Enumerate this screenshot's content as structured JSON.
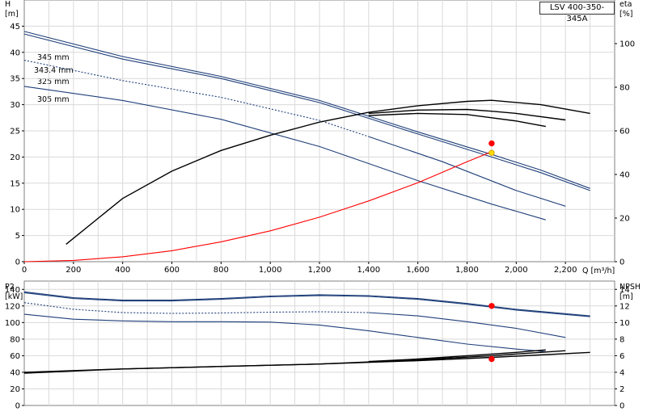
{
  "model": "LSV 400-350-345A",
  "units": {
    "H": "H",
    "H_unit": "[m]",
    "eta": "eta",
    "eta_unit": "[%]",
    "Q": "Q [m³/h]",
    "P2": "P2",
    "P2_unit": "[kW]",
    "NPSH": "NPSH",
    "NPSH_unit": "[m]"
  },
  "impeller_labels": [
    "345 mm",
    "343.4 mm",
    "325 mm",
    "305 mm"
  ],
  "colors": {
    "pump": "#1f3f7a",
    "eff": "#000000",
    "system": "#ff0000",
    "grid": "#d9d9d9"
  },
  "chart_data": [
    {
      "type": "line",
      "name_key": "head",
      "xlim": [
        0,
        2400
      ],
      "ylim": [
        0,
        50
      ],
      "y2lim": [
        0,
        120
      ],
      "xticks": [
        0,
        200,
        400,
        600,
        800,
        1000,
        1200,
        1400,
        1600,
        1800,
        2000,
        2200
      ],
      "xtick_labels": [
        "0",
        "200",
        "400",
        "600",
        "800",
        "1,000",
        "1,200",
        "1,400",
        "1,600",
        "1,800",
        "2,000",
        "2,200"
      ],
      "yticks": [
        0,
        5,
        10,
        15,
        20,
        25,
        30,
        35,
        40,
        45
      ],
      "y2ticks": [
        0,
        20,
        40,
        60,
        80,
        100
      ],
      "grid": true,
      "series": [
        {
          "name": "345 mm",
          "axis": "left",
          "style": "solid",
          "x": [
            0,
            400,
            800,
            1200,
            1600,
            1900,
            2100,
            2300
          ],
          "y": [
            44,
            39.2,
            35.4,
            30.8,
            24.8,
            20.5,
            17.5,
            14.0
          ]
        },
        {
          "name": "343.4 mm",
          "axis": "left",
          "style": "solid",
          "x": [
            0,
            400,
            800,
            1200,
            1600,
            1900,
            2100,
            2300
          ],
          "y": [
            43.5,
            38.7,
            35.0,
            30.4,
            24.4,
            20.0,
            17.0,
            13.6
          ]
        },
        {
          "name": "325 mm",
          "axis": "left",
          "style": "dashed",
          "x": [
            0,
            400,
            800,
            1200,
            1400
          ],
          "y": [
            38.5,
            34.6,
            31.4,
            27.0,
            23.9
          ]
        },
        {
          "name": "325 mm",
          "axis": "left",
          "style": "solid",
          "x": [
            1400,
            1700,
            2000,
            2200
          ],
          "y": [
            23.9,
            19.1,
            13.6,
            10.6
          ]
        },
        {
          "name": "305 mm",
          "axis": "left",
          "style": "solid",
          "x": [
            0,
            400,
            800,
            1200,
            1600,
            1900,
            2120
          ],
          "y": [
            33.5,
            30.8,
            27.2,
            22.0,
            15.5,
            11.0,
            8.0
          ]
        },
        {
          "name": "system",
          "axis": "left",
          "style": "solid",
          "color_key": "system",
          "x": [
            0,
            200,
            400,
            600,
            800,
            1000,
            1200,
            1400,
            1600,
            1800,
            1900
          ],
          "y": [
            0,
            0.24,
            0.94,
            2.1,
            3.8,
            5.9,
            8.5,
            11.6,
            15.1,
            19.1,
            21.0
          ]
        },
        {
          "name": "eta 345 mm",
          "axis": "right",
          "style": "solid",
          "color_key": "eff",
          "x": [
            170,
            400,
            600,
            800,
            1000,
            1200,
            1400,
            1600,
            1800,
            1900,
            2100,
            2300
          ],
          "y": [
            8,
            29,
            41.5,
            51,
            58,
            64,
            68.5,
            71.5,
            73.5,
            74,
            72,
            68
          ]
        },
        {
          "name": "eta 325 mm",
          "axis": "right",
          "style": "solid",
          "color_key": "eff",
          "x": [
            1400,
            1600,
            1800,
            1900,
            2000,
            2200
          ],
          "y": [
            68,
            69.5,
            69.8,
            69,
            68,
            65
          ]
        },
        {
          "name": "eta 305 mm",
          "axis": "right",
          "style": "solid",
          "color_key": "eff",
          "x": [
            1400,
            1600,
            1800,
            1900,
            2000,
            2120
          ],
          "y": [
            67,
            68,
            67.5,
            66,
            64.5,
            62
          ]
        }
      ],
      "duty_points": [
        {
          "x": 1900,
          "y": 22.6,
          "color": "#ff0000"
        },
        {
          "x": 1900,
          "y": 20.8,
          "color": "#ffd700"
        }
      ]
    },
    {
      "type": "line",
      "name_key": "power_npsh",
      "xlim": [
        0,
        2400
      ],
      "ylim": [
        0,
        150
      ],
      "y2lim": [
        0,
        15
      ],
      "yticks": [
        0,
        20,
        40,
        60,
        80,
        100,
        120,
        140
      ],
      "y2ticks": [
        0,
        2,
        4,
        6,
        8,
        10,
        12,
        14
      ],
      "grid": true,
      "series": [
        {
          "name": "P2 345 mm",
          "axis": "left",
          "style": "solid",
          "x": [
            0,
            200,
            400,
            600,
            800,
            1000,
            1200,
            1400,
            1600,
            1800,
            2000,
            2300
          ],
          "y": [
            137,
            130,
            127,
            127,
            129,
            132,
            133.5,
            132.5,
            129,
            123,
            116,
            108
          ]
        },
        {
          "name": "P2 343.4 mm",
          "axis": "left",
          "style": "solid",
          "x": [
            0,
            200,
            400,
            600,
            800,
            1000,
            1200,
            1400,
            1600,
            1800,
            2000,
            2300
          ],
          "y": [
            136,
            129,
            126,
            126,
            128,
            131,
            132.5,
            131.5,
            128,
            122,
            115,
            107
          ]
        },
        {
          "name": "P2 325 mm",
          "axis": "left",
          "style": "dashed",
          "x": [
            0,
            200,
            400,
            600,
            800,
            1000,
            1200,
            1400
          ],
          "y": [
            124,
            116,
            112,
            111,
            111.5,
            112.5,
            113,
            112
          ]
        },
        {
          "name": "P2 325 mm",
          "axis": "left",
          "style": "solid",
          "x": [
            1400,
            1600,
            1800,
            2000,
            2200
          ],
          "y": [
            112,
            108,
            101,
            93,
            82
          ]
        },
        {
          "name": "P2 305 mm",
          "axis": "left",
          "style": "solid",
          "x": [
            0,
            200,
            400,
            600,
            800,
            1000,
            1200,
            1400,
            1600,
            1800,
            2000,
            2120
          ],
          "y": [
            110,
            104,
            102,
            101,
            101,
            100.5,
            97,
            90,
            82,
            74,
            68,
            65
          ]
        },
        {
          "name": "NPSH 345 mm",
          "axis": "right",
          "style": "solid",
          "color_key": "eff",
          "x": [
            0,
            400,
            800,
            1200,
            1600,
            1900,
            2300
          ],
          "y": [
            3.9,
            4.4,
            4.7,
            5.0,
            5.4,
            5.8,
            6.4
          ]
        },
        {
          "name": "NPSH 325 mm",
          "axis": "right",
          "style": "solid",
          "color_key": "eff",
          "x": [
            0,
            400,
            800,
            1200,
            1600,
            1900,
            2200
          ],
          "y": [
            4.0,
            4.4,
            4.7,
            5.0,
            5.5,
            6.0,
            6.6
          ]
        },
        {
          "name": "NPSH 305 mm",
          "axis": "right",
          "style": "solid",
          "color_key": "eff",
          "x": [
            1400,
            1600,
            1800,
            2000,
            2120
          ],
          "y": [
            5.3,
            5.6,
            6.0,
            6.4,
            6.7
          ]
        }
      ],
      "duty_points": [
        {
          "x": 1900,
          "y": 120,
          "axis": "left",
          "color": "#ff0000"
        },
        {
          "x": 1900,
          "y": 5.6,
          "axis": "right",
          "color": "#ff0000"
        }
      ]
    }
  ]
}
